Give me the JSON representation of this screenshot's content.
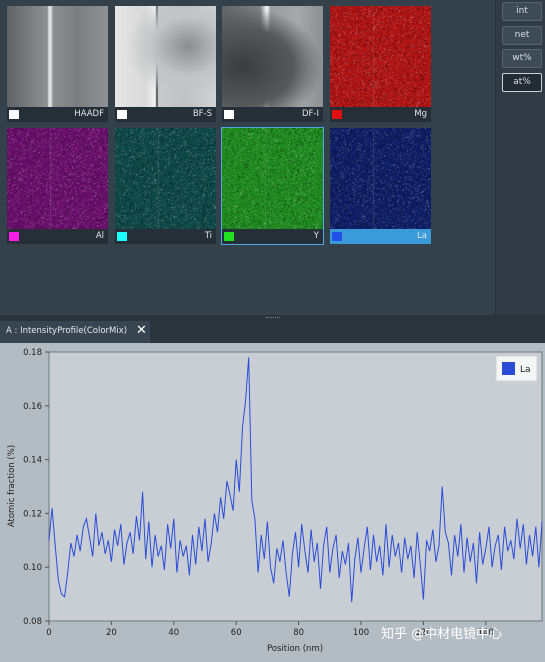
{
  "units": [
    "int",
    "net",
    "wt%",
    "at%"
  ],
  "active_unit": "at%",
  "tiles": [
    {
      "label": "HAADF",
      "swatch": "#ffffff",
      "kind": "haadf"
    },
    {
      "label": "BF-S",
      "swatch": "#ffffff",
      "kind": "bf"
    },
    {
      "label": "DF-I",
      "swatch": "#ffffff",
      "kind": "df"
    },
    {
      "label": "Mg",
      "swatch": "#e01010",
      "kind": "map",
      "color": "#b01414"
    },
    {
      "label": "Al",
      "swatch": "#ff1ee6",
      "kind": "map",
      "color": "#6a0f6c"
    },
    {
      "label": "Ti",
      "swatch": "#1effff",
      "kind": "map",
      "color": "#0f4848"
    },
    {
      "label": "Y",
      "swatch": "#20e020",
      "kind": "map",
      "color": "#1f8a1f"
    },
    {
      "label": "La",
      "swatch": "#2050e8",
      "kind": "map",
      "color": "#0f1e66"
    }
  ],
  "tab": {
    "title": "A : IntensityProfile(ColorMix)",
    "close": "✕"
  },
  "watermark": "知乎 @中材电镜中心",
  "chart_data": {
    "type": "line",
    "xlabel": "Position (nm)",
    "ylabel": "Atomic fraction (%)",
    "xlim": [
      0,
      158
    ],
    "ylim": [
      0.08,
      0.18
    ],
    "xticks": [
      0,
      20,
      40,
      60,
      80,
      100,
      120,
      140
    ],
    "yticks": [
      0.08,
      0.1,
      0.12,
      0.14,
      0.16,
      0.18
    ],
    "ytick_labels": [
      "0.08",
      "0.10",
      "0.12",
      "0.14",
      "0.16",
      "0.18"
    ],
    "legend_position": "top-right",
    "series": [
      {
        "name": "La",
        "color": "#2a4cd8",
        "x": [
          0,
          1,
          2,
          3,
          4,
          5,
          6,
          7,
          8,
          9,
          10,
          11,
          12,
          13,
          14,
          15,
          16,
          17,
          18,
          19,
          20,
          21,
          22,
          23,
          24,
          25,
          26,
          27,
          28,
          29,
          30,
          31,
          32,
          33,
          34,
          35,
          36,
          37,
          38,
          39,
          40,
          41,
          42,
          43,
          44,
          45,
          46,
          47,
          48,
          49,
          50,
          51,
          52,
          53,
          54,
          55,
          56,
          57,
          58,
          59,
          60,
          61,
          62,
          63,
          64,
          65,
          66,
          67,
          68,
          69,
          70,
          71,
          72,
          73,
          74,
          75,
          76,
          77,
          78,
          79,
          80,
          81,
          82,
          83,
          84,
          85,
          86,
          87,
          88,
          89,
          90,
          91,
          92,
          93,
          94,
          95,
          96,
          97,
          98,
          99,
          100,
          101,
          102,
          103,
          104,
          105,
          106,
          107,
          108,
          109,
          110,
          111,
          112,
          113,
          114,
          115,
          116,
          117,
          118,
          119,
          120,
          121,
          122,
          123,
          124,
          125,
          126,
          127,
          128,
          129,
          130,
          131,
          132,
          133,
          134,
          135,
          136,
          137,
          138,
          139,
          140,
          141,
          142,
          143,
          144,
          145,
          146,
          147,
          148,
          149,
          150,
          151,
          152,
          153,
          154,
          155,
          156,
          157,
          158
        ],
        "y": [
          0.11,
          0.122,
          0.108,
          0.095,
          0.09,
          0.089,
          0.098,
          0.109,
          0.104,
          0.112,
          0.106,
          0.115,
          0.118,
          0.111,
          0.104,
          0.12,
          0.108,
          0.113,
          0.105,
          0.11,
          0.102,
          0.114,
          0.108,
          0.116,
          0.101,
          0.109,
          0.113,
          0.105,
          0.119,
          0.11,
          0.128,
          0.103,
          0.117,
          0.1,
          0.112,
          0.104,
          0.108,
          0.099,
          0.116,
          0.107,
          0.118,
          0.098,
          0.11,
          0.104,
          0.108,
          0.097,
          0.112,
          0.101,
          0.115,
          0.106,
          0.118,
          0.102,
          0.109,
          0.12,
          0.113,
          0.126,
          0.118,
          0.132,
          0.127,
          0.121,
          0.14,
          0.128,
          0.152,
          0.162,
          0.178,
          0.125,
          0.118,
          0.098,
          0.112,
          0.103,
          0.117,
          0.1,
          0.094,
          0.107,
          0.102,
          0.11,
          0.098,
          0.089,
          0.105,
          0.113,
          0.1,
          0.116,
          0.106,
          0.098,
          0.114,
          0.102,
          0.109,
          0.092,
          0.108,
          0.115,
          0.098,
          0.107,
          0.112,
          0.096,
          0.106,
          0.101,
          0.109,
          0.087,
          0.103,
          0.111,
          0.098,
          0.107,
          0.115,
          0.099,
          0.112,
          0.102,
          0.108,
          0.097,
          0.116,
          0.1,
          0.112,
          0.104,
          0.109,
          0.098,
          0.111,
          0.103,
          0.108,
          0.096,
          0.113,
          0.101,
          0.088,
          0.11,
          0.106,
          0.114,
          0.102,
          0.108,
          0.13,
          0.113,
          0.109,
          0.097,
          0.112,
          0.104,
          0.116,
          0.098,
          0.111,
          0.102,
          0.109,
          0.094,
          0.113,
          0.101,
          0.107,
          0.115,
          0.1,
          0.108,
          0.112,
          0.099,
          0.115,
          0.106,
          0.11,
          0.103,
          0.118,
          0.107,
          0.116,
          0.101,
          0.112,
          0.104,
          0.115,
          0.1,
          0.117
        ]
      }
    ]
  }
}
